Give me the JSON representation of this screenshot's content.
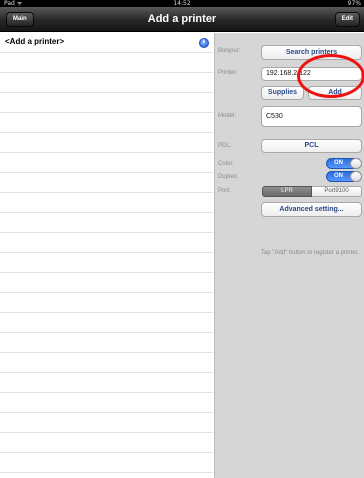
{
  "status_bar": {
    "device": "Pad ᯤ",
    "time": "14:52",
    "battery": "97%"
  },
  "nav": {
    "title": "Add a printer",
    "left_button": "Main",
    "right_button": "Edit"
  },
  "list": {
    "items": [
      {
        "label": "<Add a printer>"
      }
    ]
  },
  "form": {
    "bonjour_label": "Bonjour:",
    "search_button": "Search printers",
    "printer_label": "Printer:",
    "printer_value": "192.168.2.122",
    "supplies_button": "Supplies",
    "add_button": "Add",
    "model_label": "Model:",
    "model_value": "C530",
    "pdl_label": "PDL:",
    "pdl_value": "PCL",
    "color_label": "Color:",
    "color_toggle": "ON",
    "duplex_label": "Duplex:",
    "duplex_toggle": "ON",
    "port_label": "Port:",
    "port_options": [
      "LPR",
      "Port9100"
    ],
    "port_selected": "LPR",
    "advanced_button": "Advanced setting...",
    "hint": "Tap \"Add\" button to register a printer."
  },
  "colors": {
    "toggle_on": "#2f74e6",
    "annotation": "#e11111",
    "nav_bar": "#262626"
  }
}
